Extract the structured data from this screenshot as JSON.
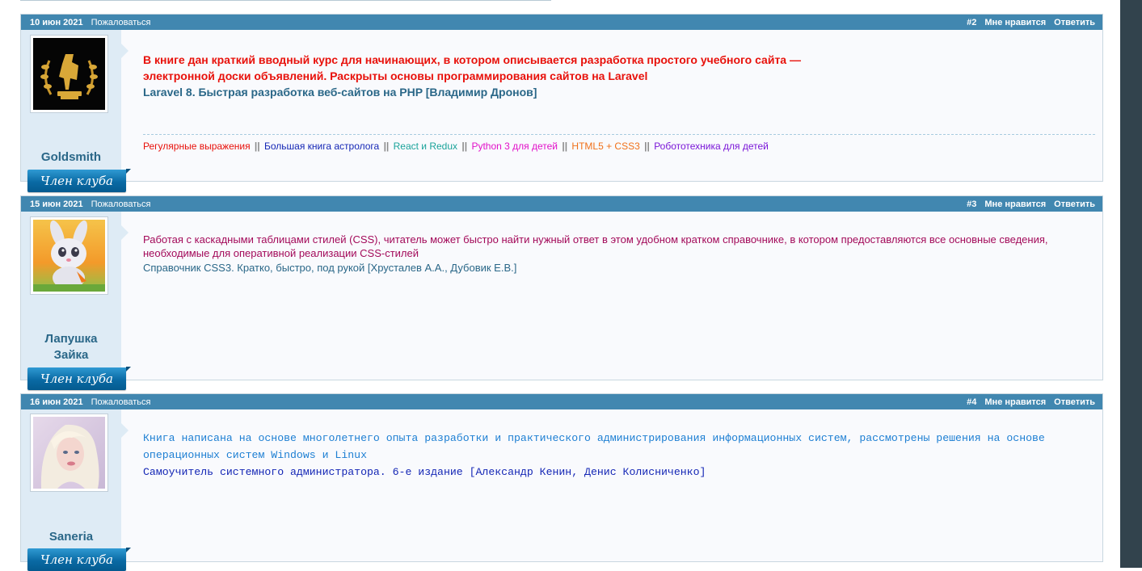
{
  "posts": [
    {
      "date": "10 июн 2021",
      "report": "Пожаловаться",
      "number": "#2",
      "like": "Мне нравится",
      "reply": "Ответить",
      "username": "Goldsmith",
      "badge": "Член клуба",
      "avatar_icon": "golden-laurel-statue-avatar",
      "text_main": "В книге дан краткий вводный курс для начинающих, в котором описывается разработка простого учебного сайта — электронной доски объявлений. Раскрыты основы программирования сайтов на Laravel",
      "text_title": "Laravel 8. Быстрая разработка веб-сайтов на PHP [Владимир Дронов]",
      "signature_links": [
        {
          "label": "Регулярные выражения",
          "color": "#e8110b"
        },
        {
          "label": "Большая книга астролога",
          "color": "#1426b5"
        },
        {
          "label": "React и Redux",
          "color": "#1aa39a"
        },
        {
          "label": "Python 3 для детей",
          "color": "#e212c9"
        },
        {
          "label": "HTML5 + CSS3",
          "color": "#f0711a"
        },
        {
          "label": "Робототехника для детей",
          "color": "#7a16d8"
        }
      ],
      "signature_separator": "||"
    },
    {
      "date": "15 июн 2021",
      "report": "Пожаловаться",
      "number": "#3",
      "like": "Мне нравится",
      "reply": "Ответить",
      "username": "Лапушка Зайка",
      "badge": "Член клуба",
      "avatar_icon": "cartoon-bunny-avatar",
      "text_main": "Работая с каскадными таблицами стилей (CSS), читатель может быстро найти нужный ответ в этом удобном кратком справочнике, в котором предоставляются все основные сведения, необходимые для оперативной реализации CSS-стилей",
      "text_title": "Справочник CSS3. Кратко, быстро, под рукой [Хрусталев А.А., Дубовик Е.В.]"
    },
    {
      "date": "16 июн 2021",
      "report": "Пожаловаться",
      "number": "#4",
      "like": "Мне нравится",
      "reply": "Ответить",
      "username": "Saneria",
      "badge": "Член клуба",
      "avatar_icon": "blonde-girl-avatar",
      "text_main": "Книга написана на основе многолетнего опыта разработки и практического администрирования информационных систем, рассмотрены решения на основе операционных систем Windows и Linux",
      "text_title": "Самоучитель системного администратора. 6-е издание [Александр Кенин, Денис Колисниченко]"
    }
  ],
  "colors": {
    "header_bg": "#4187b0",
    "post_bg": "#f9fafd",
    "userinfo_bg": "#deebf5",
    "username": "#2a6788",
    "gutter": "#32434d"
  }
}
